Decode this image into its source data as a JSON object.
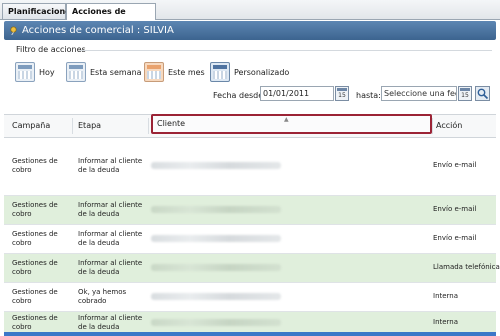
{
  "tabs": [
    {
      "label": "Planificaciones"
    },
    {
      "label": "Acciones de comercial"
    }
  ],
  "panel": {
    "title": "Acciones de comercial : SILVIA"
  },
  "filter": {
    "group_label": "Filtro de acciones",
    "buttons": [
      {
        "label": "Hoy",
        "icon": "calendar-day-icon"
      },
      {
        "label": "Esta semana",
        "icon": "calendar-week-icon"
      },
      {
        "label": "Este mes",
        "icon": "calendar-month-icon"
      },
      {
        "label": "Personalizado",
        "icon": "calendar-custom-icon"
      }
    ],
    "fecha_desde_label": "Fecha desde:",
    "fecha_desde_value": "01/01/2011",
    "hasta_label": "hasta:",
    "hasta_placeholder": "Seleccione una fecha",
    "calendar_day": "15"
  },
  "grid": {
    "columns": [
      "Campaña",
      "Etapa",
      "Cliente",
      "Acción"
    ],
    "rows": [
      {
        "campana": "Gestiones de cobro",
        "etapa": "Informar al cliente de la deuda",
        "accion": "Envío e-mail"
      },
      {
        "campana": "Gestiones de cobro",
        "etapa": "Informar al cliente de la deuda",
        "accion": "Envío e-mail"
      },
      {
        "campana": "Gestiones de cobro",
        "etapa": "Informar al cliente de la deuda",
        "accion": "Envío e-mail"
      },
      {
        "campana": "Gestiones de cobro",
        "etapa": "Informar al cliente de la deuda",
        "accion": "Llamada telefónica"
      },
      {
        "campana": "Gestiones de cobro",
        "etapa": "Ok, ya hemos cobrado",
        "accion": "Interna"
      },
      {
        "campana": "Gestiones de cobro",
        "etapa": "Informar al cliente de la deuda",
        "accion": "Interna"
      }
    ]
  },
  "colors": {
    "title_bar": "#4a73a0",
    "row_alt": "#e0efdc",
    "highlight_border": "#9b2335"
  }
}
